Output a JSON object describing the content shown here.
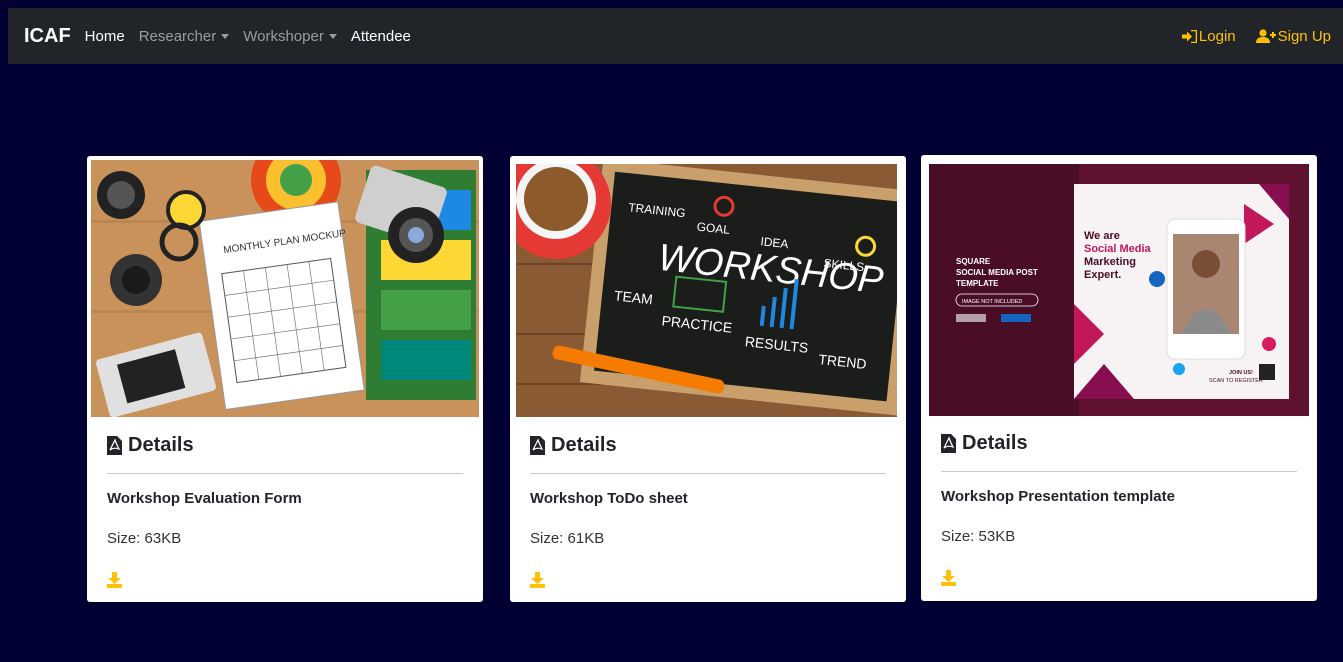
{
  "navbar": {
    "brand": "ICAF",
    "links": [
      {
        "label": "Home"
      },
      {
        "label": "Researcher"
      },
      {
        "label": "Workshoper"
      },
      {
        "label": "Attendee"
      }
    ],
    "login_label": "Login",
    "signup_label": "Sign Up"
  },
  "cards": [
    {
      "heading": "Details",
      "title": "Workshop Evaluation Form",
      "size": "Size: 63KB",
      "image_mockup_text": "MONTHLY PLAN MOCKUP"
    },
    {
      "heading": "Details",
      "title": "Workshop ToDo sheet",
      "size": "Size: 61KB",
      "image_board_word": "WORKSHOP",
      "image_board_words": [
        "TRAINING",
        "GOAL",
        "IDEA",
        "SKILLS",
        "TEAM",
        "PRACTICE",
        "RESULTS",
        "TREND"
      ]
    },
    {
      "heading": "Details",
      "title": "Workshop Presentation template",
      "size": "Size: 53KB",
      "image_left_text": [
        "SQUARE",
        "SOCIAL MEDIA POST",
        "TEMPLATE"
      ],
      "image_badge": "IMAGE NOT INCLUDED",
      "image_poster_text": [
        "We are",
        "Social Media",
        "Marketing",
        "Expert."
      ],
      "image_poster_footer": [
        "JOIN US!",
        "SCAN TO REGISTER"
      ]
    }
  ],
  "colors": {
    "page_bg": "#000033",
    "navbar_bg": "#212529",
    "accent": "#ffc107"
  }
}
